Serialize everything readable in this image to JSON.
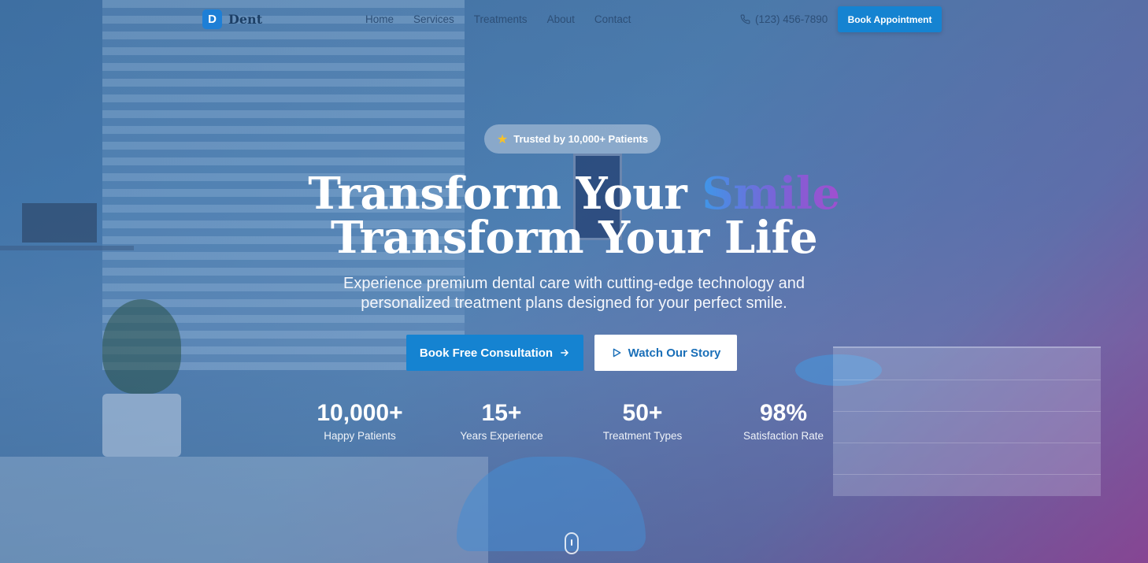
{
  "nav": {
    "logo_letter": "D",
    "logo_text": "Dent",
    "links": [
      "Home",
      "Services",
      "Treatments",
      "About",
      "Contact"
    ],
    "phone": "(123) 456-7890",
    "book_label": "Book Appointment"
  },
  "hero": {
    "badge": "Trusted by 10,000+ Patients",
    "headline_line1_prefix": "Transform Your",
    "headline_line1_accent": "Smile",
    "headline_line2": "Transform Your Life",
    "subtitle": "Experience premium dental care with cutting-edge technology and personalized treatment plans designed for your perfect smile.",
    "primary_cta": "Book Free Consultation",
    "secondary_cta": "Watch Our Story"
  },
  "stats": [
    {
      "value": "10,000+",
      "label": "Happy Patients"
    },
    {
      "value": "15+",
      "label": "Years Experience"
    },
    {
      "value": "50+",
      "label": "Treatment Types"
    },
    {
      "value": "98%",
      "label": "Satisfaction Rate"
    }
  ],
  "colors": {
    "brand": "#1583d1",
    "accent_gradient_start": "#3f97e8",
    "accent_gradient_end": "#a04fcf",
    "star": "#f6c12a"
  },
  "icons": {
    "star": "star-icon",
    "phone": "phone-icon",
    "arrow": "arrow-right-icon",
    "play": "play-icon",
    "scroll": "scroll-mouse-icon"
  }
}
